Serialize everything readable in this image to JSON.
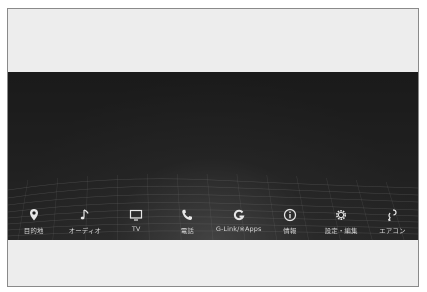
{
  "menu": {
    "items": [
      {
        "label": "目的地",
        "icon": "location-pin-icon"
      },
      {
        "label": "オーディオ",
        "icon": "music-note-icon"
      },
      {
        "label": "TV",
        "icon": "tv-icon"
      },
      {
        "label": "電話",
        "icon": "phone-icon"
      },
      {
        "label": "G-Link/※Apps",
        "icon": "g-link-icon"
      },
      {
        "label": "情報",
        "icon": "info-icon"
      },
      {
        "label": "設定・編集",
        "icon": "gear-icon"
      },
      {
        "label": "エアコン",
        "icon": "air-conditioner-icon"
      }
    ]
  },
  "colors": {
    "screen_background": "#1b1b1b",
    "label_text": "#d9d9d9",
    "icon": "#e6e6e6",
    "frame_background": "#ececec"
  }
}
